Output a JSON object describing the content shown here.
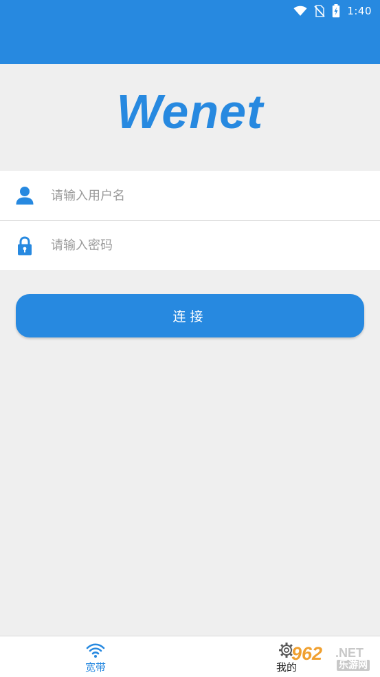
{
  "status_bar": {
    "time": "1:40",
    "icons": [
      "wifi-icon",
      "no-sim-icon",
      "battery-charging-icon"
    ]
  },
  "app": {
    "logo_text": "Wenet",
    "brand_color": "#2789e0"
  },
  "login_form": {
    "username": {
      "placeholder": "请输入用户名",
      "value": "",
      "icon": "user-icon"
    },
    "password": {
      "placeholder": "请输入密码",
      "value": "",
      "icon": "lock-icon"
    },
    "connect_label": "连接"
  },
  "tab_bar": {
    "tabs": [
      {
        "label": "宽带",
        "icon": "wifi-icon",
        "active": true
      },
      {
        "label": "我的",
        "icon": "gear-icon",
        "active": false
      }
    ]
  },
  "watermark": {
    "number": "962",
    "suffix": ".NET",
    "cn": "乐游网"
  }
}
